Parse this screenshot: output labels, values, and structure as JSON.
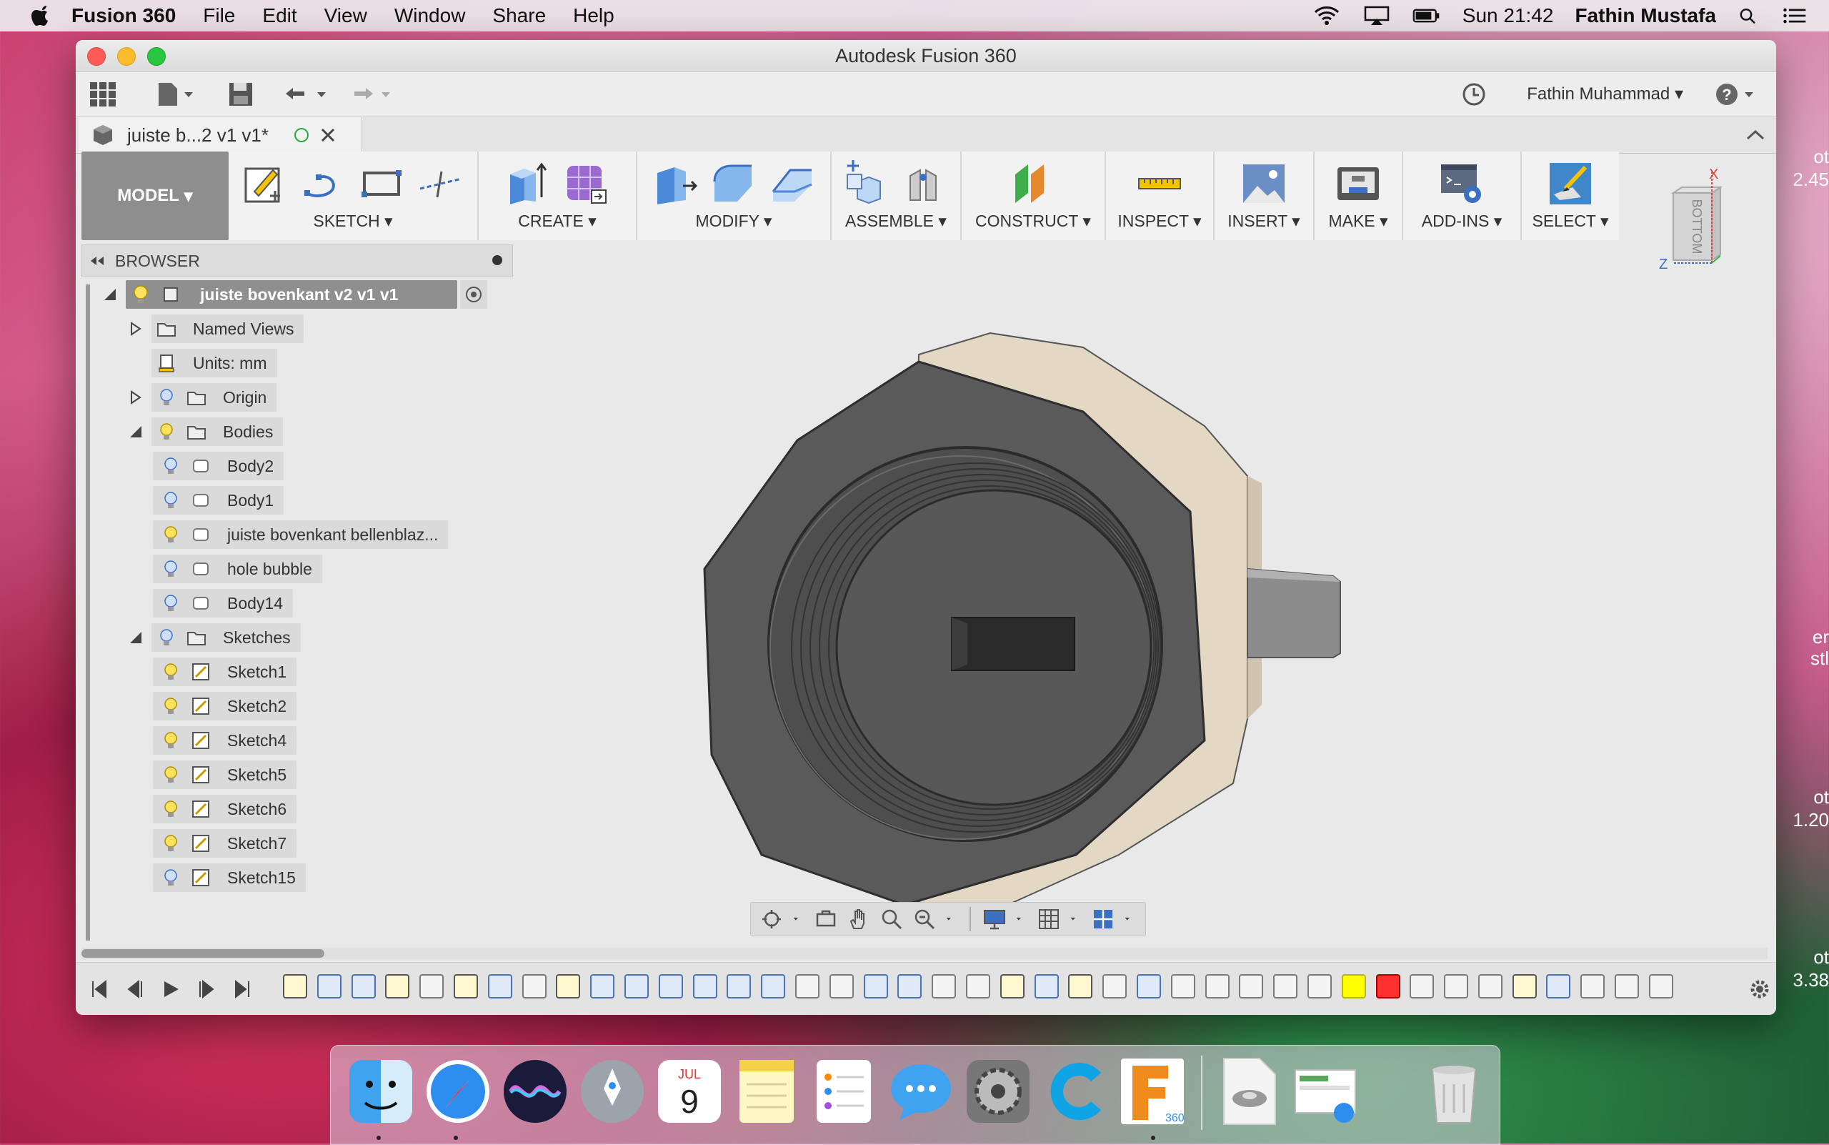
{
  "menubar": {
    "app_name": "Fusion 360",
    "items": [
      "File",
      "Edit",
      "View",
      "Window",
      "Share",
      "Help"
    ],
    "clock": "Sun 21:42",
    "user": "Fathin Mustafa"
  },
  "window": {
    "title": "Autodesk Fusion 360",
    "user_menu": "Fathin Muhammad",
    "document_tab": "juiste b...2 v1 v1*"
  },
  "toolbar": {
    "workspace": "MODEL",
    "groups": [
      "SKETCH",
      "CREATE",
      "MODIFY",
      "ASSEMBLE",
      "CONSTRUCT",
      "INSPECT",
      "INSERT",
      "MAKE",
      "ADD-INS",
      "SELECT"
    ]
  },
  "viewcube": {
    "face": "BOTTOM",
    "axis_x": "X",
    "axis_z": "Z"
  },
  "browser": {
    "title": "BROWSER",
    "root": "juiste bovenkant v2 v1 v1",
    "named_views": "Named Views",
    "units": "Units: mm",
    "origin": "Origin",
    "bodies_folder": "Bodies",
    "bodies": [
      "Body2",
      "Body1",
      "juiste bovenkant bellenblaz...",
      "hole bubble",
      "Body14"
    ],
    "sketches_folder": "Sketches",
    "sketches": [
      "Sketch1",
      "Sketch2",
      "Sketch4",
      "Sketch5",
      "Sketch6",
      "Sketch7",
      "Sketch15"
    ]
  },
  "right_peek": {
    "t1": "ot",
    "t2": "2.45",
    "t3": "er",
    "t4": "stl",
    "t5": "ot",
    "t6": "1.20",
    "t7": "ot",
    "t8": "3.38"
  },
  "dock": {
    "calendar_month": "JUL",
    "calendar_day": "9",
    "fusion_badge": "360"
  },
  "colors": {
    "accent_blue": "#4a74b8",
    "model_bg": "#8e8e8e",
    "body_dark": "#595959",
    "body_tan": "#e2d8c3"
  }
}
